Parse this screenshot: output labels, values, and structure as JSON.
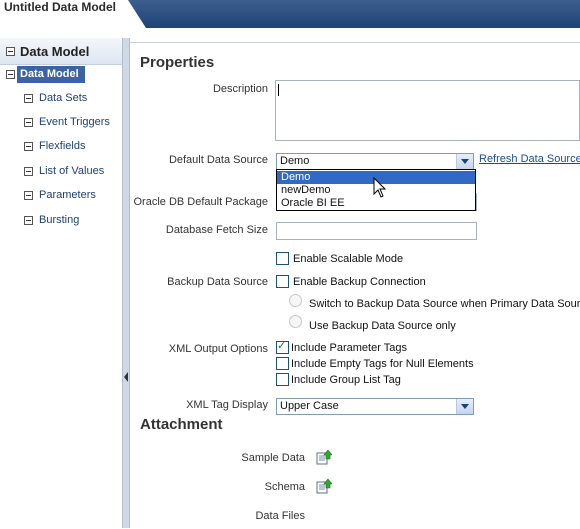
{
  "window": {
    "title": "Untitled Data Model"
  },
  "left_panel": {
    "header": "Data Model",
    "root": "Data Model",
    "items": [
      {
        "label": "Data Sets"
      },
      {
        "label": "Event Triggers"
      },
      {
        "label": "Flexfields"
      },
      {
        "label": "List of Values"
      },
      {
        "label": "Parameters"
      },
      {
        "label": "Bursting"
      }
    ]
  },
  "properties": {
    "title": "Properties",
    "description_label": "Description",
    "description_value": "",
    "default_ds_label": "Default Data Source",
    "default_ds_value": "Demo",
    "refresh_link": "Refresh Data Source",
    "dropdown_options": [
      "Demo",
      "newDemo",
      "Oracle BI EE"
    ],
    "dropdown_selected": "Demo",
    "oracle_pkg_label": "Oracle DB Default Package",
    "fetch_size_label": "Database Fetch Size",
    "fetch_size_value": "",
    "scalable_label": "Enable Scalable Mode",
    "scalable_checked": false,
    "backup_ds_label": "Backup Data Source",
    "backup_conn_label": "Enable Backup Connection",
    "backup_conn_checked": false,
    "switch_backup_label": "Switch to Backup Data Source when Primary Data Source is unavailable",
    "use_backup_label": "Use Backup Data Source only",
    "xml_options_label": "XML Output Options",
    "param_tags_label": "Include Parameter Tags",
    "param_tags_checked": true,
    "empty_tags_label": "Include Empty Tags for Null Elements",
    "empty_tags_checked": false,
    "group_list_label": "Include Group List Tag",
    "group_list_checked": false,
    "xml_tag_label": "XML Tag Display",
    "xml_tag_value": "Upper Case"
  },
  "attachment": {
    "title": "Attachment",
    "sample_data_label": "Sample Data",
    "schema_label": "Schema",
    "data_files_label": "Data Files"
  },
  "icons": {
    "upload": "upload-icon",
    "cursor": "mouse-cursor-icon",
    "collapse": "collapse-toggle-icon"
  },
  "colors": {
    "title_bar": "#1f4375",
    "selection": "#3169c6",
    "tree_selection": "#3c63a4",
    "link": "#1a4d9a"
  }
}
